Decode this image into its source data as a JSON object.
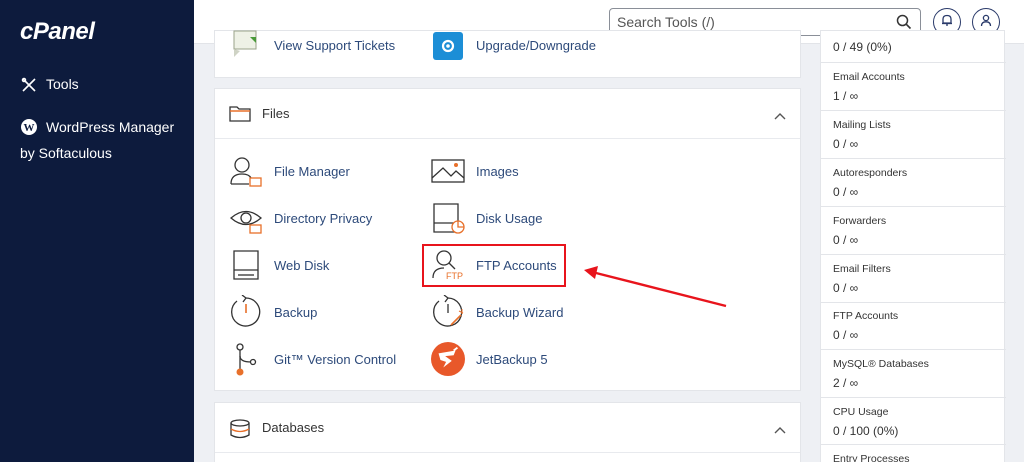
{
  "sidebar": {
    "logo": "cPanel",
    "items": [
      {
        "label": "Tools"
      },
      {
        "label": "WordPress Manager",
        "label2": "by Softaculous"
      }
    ]
  },
  "topbar": {
    "search_placeholder": "Search Tools (/)"
  },
  "prev_panel": {
    "items": [
      {
        "label": "View Support Tickets"
      },
      {
        "label": "Upgrade/Downgrade"
      }
    ]
  },
  "files": {
    "title": "Files",
    "items": [
      {
        "label": "File Manager"
      },
      {
        "label": "Images"
      },
      {
        "label": "Directory Privacy"
      },
      {
        "label": "Disk Usage"
      },
      {
        "label": "Web Disk"
      },
      {
        "label": "FTP Accounts"
      },
      {
        "label": "Backup"
      },
      {
        "label": "Backup Wizard"
      },
      {
        "label": "Git™ Version Control"
      },
      {
        "label": "JetBackup 5"
      }
    ]
  },
  "databases": {
    "title": "Databases"
  },
  "stats": [
    {
      "label": "",
      "value": "0 / 49   (0%)"
    },
    {
      "label": "Email Accounts",
      "value": "1 / ∞"
    },
    {
      "label": "Mailing Lists",
      "value": "0 / ∞"
    },
    {
      "label": "Autoresponders",
      "value": "0 / ∞"
    },
    {
      "label": "Forwarders",
      "value": "0 / ∞"
    },
    {
      "label": "Email Filters",
      "value": "0 / ∞"
    },
    {
      "label": "FTP Accounts",
      "value": "0 / ∞"
    },
    {
      "label": "MySQL® Databases",
      "value": "2 / ∞"
    },
    {
      "label": "CPU Usage",
      "value": "0 / 100   (0%)"
    },
    {
      "label": "Entry Processes",
      "value": ""
    }
  ],
  "colors": {
    "sidebar_bg": "#0d1b3d",
    "link": "#2d4a7a",
    "accent_orange": "#e8702a",
    "highlight_red": "#e8141c"
  }
}
